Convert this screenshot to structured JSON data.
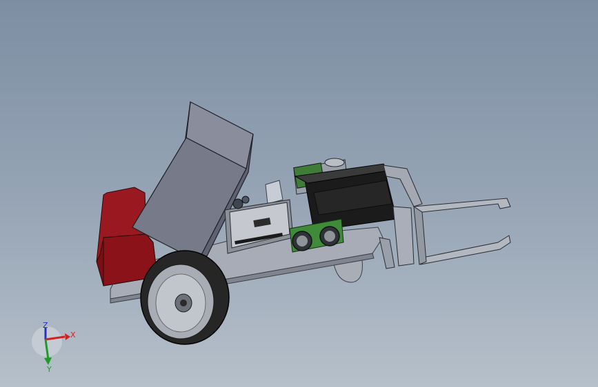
{
  "triad": {
    "x_label": "X",
    "y_label": "Y",
    "z_label": "Z",
    "x_color": "#d42020",
    "y_color": "#1f9a2a",
    "z_color": "#2030c0"
  },
  "model": {
    "chassis_color": "#a3a8b3",
    "hopper_color": "#6f7280",
    "battery_color": "#8b1218",
    "wheel_color": "#2a2a2a",
    "board_color": "#4a8a3a",
    "battery_pack_color": "#151515",
    "fork_color": "#9aa0ab"
  }
}
